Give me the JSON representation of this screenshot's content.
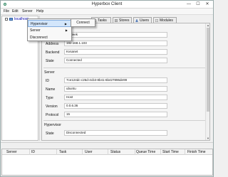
{
  "window": {
    "title": "Hyperbox Client",
    "minimize": "—",
    "maximize": "☐",
    "close": "✕"
  },
  "menubar": [
    "File",
    "Edit",
    "Server",
    "Help"
  ],
  "tree": {
    "selected_label": "localhost"
  },
  "tabs": [
    {
      "label": "Tasks",
      "icon": "list-icon"
    },
    {
      "label": "Stores",
      "icon": "disk-icon"
    },
    {
      "label": "Users",
      "icon": "users-icon"
    },
    {
      "label": "Modules",
      "icon": "grid-icon"
    }
  ],
  "connector": {
    "fields": [
      {
        "label": "ID",
        "value": "7fa8eek"
      },
      {
        "label": "Address",
        "value": "192.168.1.103"
      },
      {
        "label": "Backend",
        "value": "Kvsanet"
      },
      {
        "label": "State",
        "value": "Connected"
      }
    ]
  },
  "server": {
    "section": "Server",
    "fields": [
      {
        "label": "ID",
        "value": "7ce124dc-c26d-4cb3-8b41-6b427896de99"
      },
      {
        "label": "Name",
        "value": "ubuntu"
      },
      {
        "label": "Type",
        "value": "Host"
      },
      {
        "label": "Version",
        "value": "0.0.6.36"
      },
      {
        "label": "Protocol",
        "value": "15"
      }
    ]
  },
  "hypervisor": {
    "section": "Hypervisor",
    "fields": [
      {
        "label": "State",
        "value": "Disconnected"
      }
    ]
  },
  "task_table": {
    "columns": [
      "Server",
      "ID",
      "Task",
      "User",
      "Status",
      "Queue Time",
      "Start Time",
      "Finish Time"
    ]
  },
  "context_menu": {
    "items": [
      "Hypervisor",
      "Server",
      "Disconnect"
    ],
    "submenu_item": "Connect"
  }
}
